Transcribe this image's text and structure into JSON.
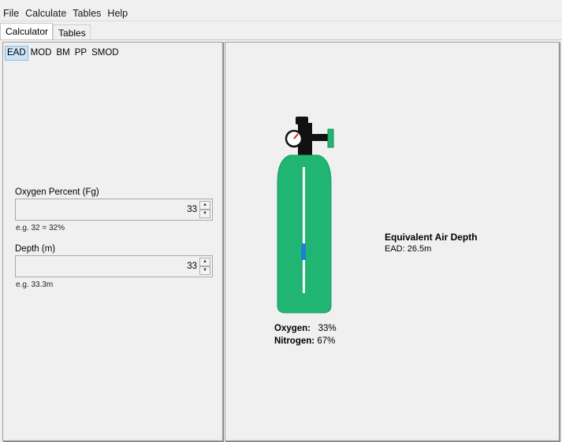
{
  "menubar": {
    "items": [
      "File",
      "Calculate",
      "Tables",
      "Help"
    ]
  },
  "tabs": {
    "calculator": "Calculator",
    "tables": "Tables"
  },
  "modes": {
    "items": [
      "EAD",
      "MOD",
      "BM",
      "PP",
      "SMOD"
    ],
    "active": "EAD"
  },
  "inputs": {
    "oxygen": {
      "label": "Oxygen Percent (Fg)",
      "value": "33",
      "hint": "e.g. 32 = 32%"
    },
    "depth": {
      "label": "Depth (m)",
      "value": "33",
      "hint": "e.g. 33.3m"
    }
  },
  "result": {
    "title": "Equivalent Air Depth",
    "value_line": "EAD: 26.5m"
  },
  "gas": {
    "oxygen_label": "Oxygen:",
    "oxygen_value": "33%",
    "nitrogen_label": "Nitrogen:",
    "nitrogen_value": "67%"
  },
  "colors": {
    "tank_green": "#20b573",
    "tank_outline": "#1c9a62",
    "valve_black": "#111111",
    "gauge_needle": "#e02020",
    "level_marker": "#1e7fd8",
    "selected_mode_bg": "#cce4f7"
  }
}
